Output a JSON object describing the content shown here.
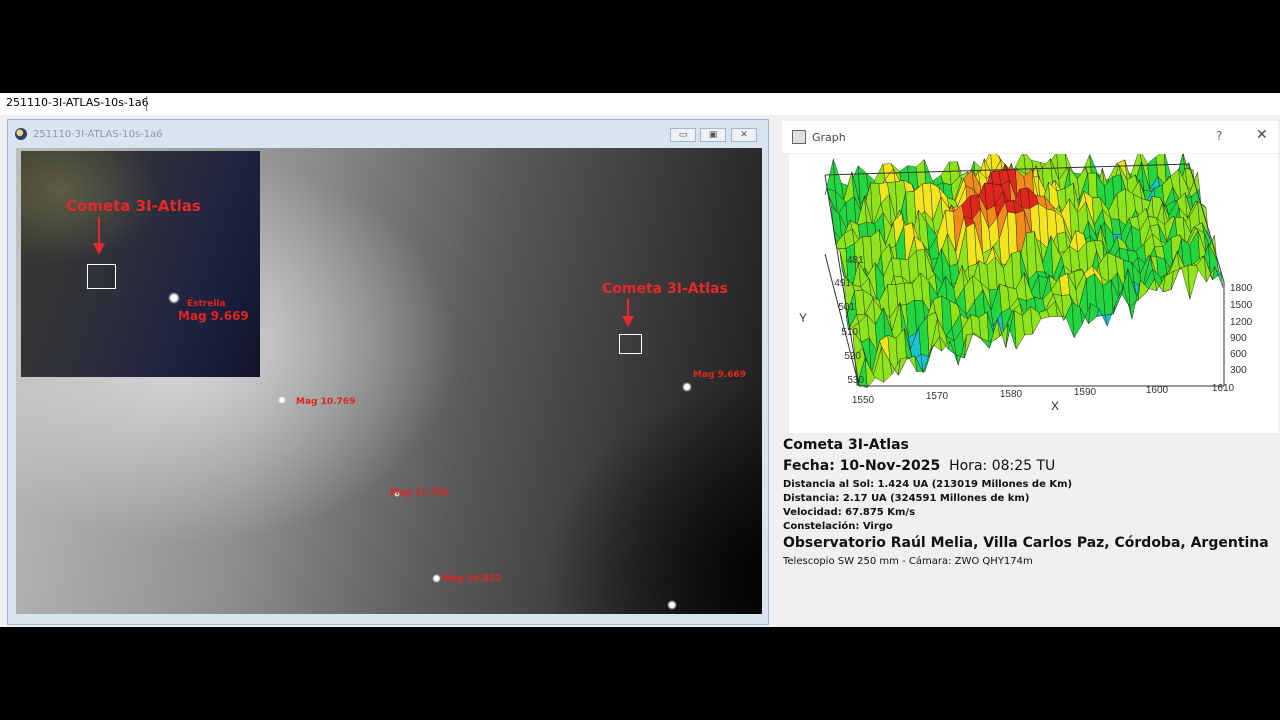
{
  "tabbar": {
    "tab_label": "251110-3I-ATLAS-10s-1a6"
  },
  "image_window": {
    "title": "251110-3I-ATLAS-10s-1a6",
    "buttons": {
      "minimize": "▭",
      "maximize": "▣",
      "close": "✕"
    },
    "annotations": {
      "comet_main": "Cometa 3I-Atlas",
      "mag_star_right": "Mag 9.669",
      "mag_left": "Mag 10.769",
      "mag_center": "Mag 11.792",
      "mag_bottom": "Mag 10.822"
    },
    "inset": {
      "comet_label": "Cometa 3I-Atlas",
      "star_label": "Estrella",
      "star_mag": "Mag 9.669"
    }
  },
  "graph_window": {
    "title": "Graph",
    "help": "?",
    "close": "✕",
    "surface_colors": [
      "#1c6fd6",
      "#19c2d0",
      "#23d640",
      "#8fe31a",
      "#f2e51d",
      "#f08a1a",
      "#e0261c"
    ],
    "axes": {
      "y_label": "Y",
      "x_label": "X",
      "y_ticks": [
        "481",
        "491",
        "501",
        "510",
        "520",
        "530"
      ],
      "x_ticks": [
        "1550",
        "1570",
        "1580",
        "1590",
        "1600",
        "1610"
      ],
      "z_ticks": [
        "1800",
        "1500",
        "1200",
        "900",
        "600",
        "300"
      ]
    }
  },
  "info": {
    "title": "Cometa 3I-Atlas",
    "fecha": "Fecha: 10-Nov-2025",
    "hora": "Hora: 08:25 TU",
    "dist_sol": "Distancia al Sol: 1.424 UA  (213019 Millones de Km)",
    "distancia": "Distancia: 2.17 UA   (324591 Millones de km)",
    "velocidad": "Velocidad: 67.875 Km/s",
    "constelacion": "Constelación: Virgo",
    "observatorio": "Observatorio Raúl Melia, Villa Carlos Paz, Córdoba, Argentina",
    "equipo": "Telescopio SW 250 mm - Cámara: ZWO QHY174m"
  }
}
